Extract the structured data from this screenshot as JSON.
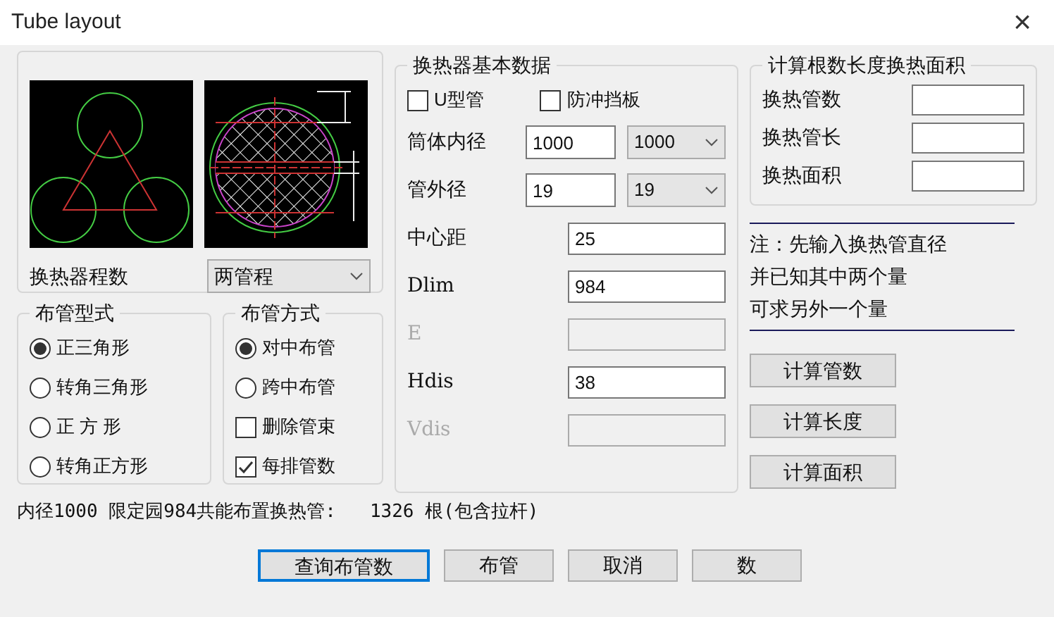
{
  "window": {
    "title": "Tube layout",
    "close": "×"
  },
  "passes": {
    "label": "换热器程数",
    "value": "两管程"
  },
  "layout_pattern": {
    "title": "布管型式",
    "options": [
      {
        "label": "正三角形",
        "selected": true
      },
      {
        "label": "转角三角形",
        "selected": false
      },
      {
        "label": "正 方 形",
        "selected": false
      },
      {
        "label": "转角正方形",
        "selected": false
      }
    ]
  },
  "layout_method": {
    "title": "布管方式",
    "items": [
      {
        "kind": "radio",
        "label": "对中布管",
        "selected": true
      },
      {
        "kind": "radio",
        "label": "跨中布管",
        "selected": false
      },
      {
        "kind": "checkbox",
        "label": "删除管束",
        "checked": false
      },
      {
        "kind": "checkbox",
        "label": "每排管数",
        "checked": true
      }
    ]
  },
  "basic_data": {
    "title": "换热器基本数据",
    "checks": [
      {
        "label": "U型管",
        "checked": false
      },
      {
        "label": "防冲挡板",
        "checked": false
      }
    ],
    "fields": [
      {
        "kind": "combo",
        "label": "筒体内径",
        "value": "1000",
        "select": "1000",
        "disabled": false
      },
      {
        "kind": "combo",
        "label": "管外径",
        "value": "19",
        "select": "19",
        "disabled": false
      },
      {
        "kind": "text",
        "label": "中心距",
        "value": "25",
        "disabled": false
      },
      {
        "kind": "text",
        "label": "Dlim",
        "value": "984",
        "disabled": false
      },
      {
        "kind": "text",
        "label": "E",
        "disabled": true
      },
      {
        "kind": "text",
        "label": "Hdis",
        "value": "38",
        "disabled": false
      },
      {
        "kind": "text",
        "label": "Vdis",
        "disabled": true
      }
    ]
  },
  "calc": {
    "title": "计算根数长度换热面积",
    "fields": [
      {
        "label": "换热管数"
      },
      {
        "label": "换热管长"
      },
      {
        "label": "换热面积"
      }
    ],
    "notes": [
      "注：先输入换热管直径",
      "并已知其中两个量",
      "可求另外一个量"
    ],
    "buttons": [
      "计算管数",
      "计算长度",
      "计算面积"
    ]
  },
  "status": {
    "text": "内径1000 限定园984共能布置换热管:",
    "result": "1326 根(包含拉杆)"
  },
  "buttons": [
    {
      "label": "查询布管数",
      "default": true
    },
    {
      "label": "布管",
      "default": false
    },
    {
      "label": "取消",
      "default": false
    },
    {
      "label": "数",
      "default": false
    }
  ]
}
